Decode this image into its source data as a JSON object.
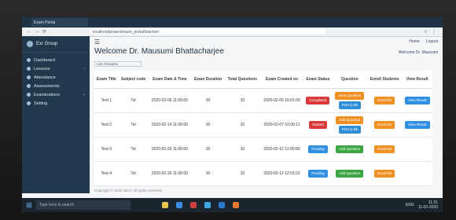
{
  "browser": {
    "tab_title": "Exam Portal",
    "url": "localhost/project/exam_portal/teacher/",
    "nav": [
      "←",
      "→",
      "⟳"
    ],
    "icons": [
      "☆",
      "⋮"
    ]
  },
  "sidebar": {
    "brand": "Exr Group",
    "items": [
      {
        "label": "Dashboard",
        "chevron": ""
      },
      {
        "label": "Lessons",
        "chevron": "‹"
      },
      {
        "label": "Attendance",
        "chevron": ""
      },
      {
        "label": "Assessments",
        "chevron": ""
      },
      {
        "label": "Examinations",
        "chevron": "‹"
      },
      {
        "label": "Setting",
        "chevron": ""
      }
    ]
  },
  "header": {
    "hamburger": "☰",
    "top_right": [
      "Home",
      "Logout"
    ],
    "welcome": "Welcome Dr. Mausumi Bhattacharjee",
    "welcome_right": "Welcome Dr. Mausumi",
    "breadcrumb": "List of Exams"
  },
  "table": {
    "columns": [
      "Exam Title",
      "Subject code",
      "Exam Date & Time",
      "Exam Duration",
      "Total Questions",
      "Exam Created on",
      "Exam Status",
      "Question",
      "Enroll Students",
      "View Result"
    ],
    "rows": [
      {
        "title": "Test 1",
        "subject": "Tst",
        "datetime": "2020-02-06 11:00:00",
        "duration": "30",
        "questions": "10",
        "created": "2020-02-05 16:01:09",
        "status": "Completed",
        "status_color": "red",
        "question_actions": [
          "View Question",
          "Print Q Bk"
        ],
        "enroll": "Enroll list",
        "result": "View Result"
      },
      {
        "title": "Test 2",
        "subject": "Tst",
        "datetime": "2020-02-14 11:00:00",
        "duration": "30",
        "questions": "10",
        "created": "2020-02-07 10:00:11",
        "status": "Started",
        "status_color": "red",
        "question_actions": [
          "Add Question",
          "Print Q Bk"
        ],
        "enroll": "Enroll list",
        "result": "View Result"
      },
      {
        "title": "Test 3",
        "subject": "Tst",
        "datetime": "2020-02-20 11:00:00",
        "duration": "30",
        "questions": "10",
        "created": "2020-02-12 12:00:00",
        "status": "Pending",
        "status_color": "blue",
        "question_actions": [
          "Add Question"
        ],
        "enroll": "Enroll list",
        "result": ""
      },
      {
        "title": "Test 4",
        "subject": "Tst",
        "datetime": "2020-02-26 11:00:00",
        "duration": "30",
        "questions": "10",
        "created": "2020-02-12 12:01:01",
        "status": "Pending",
        "status_color": "blue",
        "question_actions": [
          "Add Question"
        ],
        "enroll": "Enroll list",
        "result": ""
      }
    ]
  },
  "footer": {
    "text": "Copyright © 2020 JECT. All rights reserved."
  },
  "taskbar": {
    "search_placeholder": "Type here to search",
    "tray_lang": "ENG",
    "time": "11:31",
    "date": "11-02-2020"
  }
}
